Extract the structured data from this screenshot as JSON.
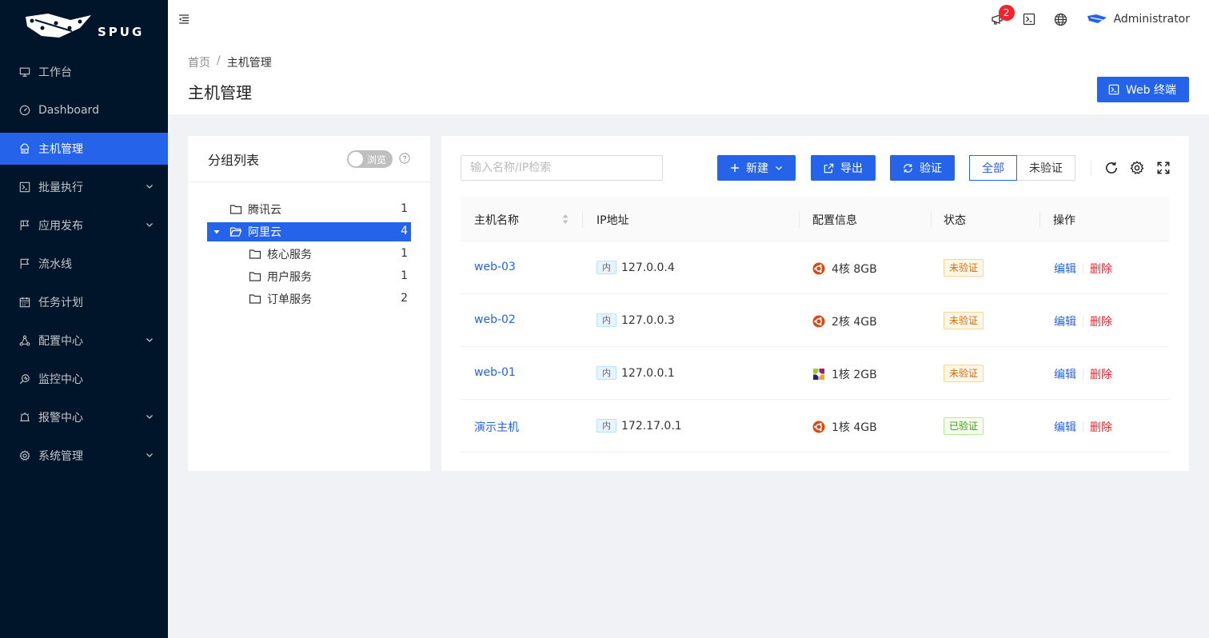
{
  "app": {
    "logo_text": "SPUG"
  },
  "sidebar": {
    "items": [
      {
        "label": "工作台",
        "icon": "desktop-icon",
        "has_children": false,
        "active": false
      },
      {
        "label": "Dashboard",
        "icon": "dashboard-icon",
        "has_children": false,
        "active": false
      },
      {
        "label": "主机管理",
        "icon": "cloud-server-icon",
        "has_children": false,
        "active": true
      },
      {
        "label": "批量执行",
        "icon": "code-icon",
        "has_children": true,
        "active": false
      },
      {
        "label": "应用发布",
        "icon": "flag-icon",
        "has_children": true,
        "active": false
      },
      {
        "label": "流水线",
        "icon": "pipeline-icon",
        "has_children": false,
        "active": false
      },
      {
        "label": "任务计划",
        "icon": "schedule-icon",
        "has_children": false,
        "active": false
      },
      {
        "label": "配置中心",
        "icon": "deployment-icon",
        "has_children": true,
        "active": false
      },
      {
        "label": "监控中心",
        "icon": "monitor-icon",
        "has_children": false,
        "active": false
      },
      {
        "label": "报警中心",
        "icon": "alert-icon",
        "has_children": true,
        "active": false
      },
      {
        "label": "系统管理",
        "icon": "setting-icon",
        "has_children": true,
        "active": false
      }
    ]
  },
  "header": {
    "notify_count": "2",
    "user_name": "Administrator"
  },
  "page": {
    "breadcrumb": [
      "首页",
      "主机管理"
    ],
    "title": "主机管理",
    "web_terminal_label": "Web 终端"
  },
  "groups": {
    "title": "分组列表",
    "switch_label": "浏览",
    "tree": [
      {
        "name": "腾讯云",
        "count": "1",
        "level": 1,
        "expanded": false,
        "selected": false
      },
      {
        "name": "阿里云",
        "count": "4",
        "level": 1,
        "expanded": true,
        "selected": true
      },
      {
        "name": "核心服务",
        "count": "1",
        "level": 2,
        "expanded": false,
        "selected": false
      },
      {
        "name": "用户服务",
        "count": "1",
        "level": 2,
        "expanded": false,
        "selected": false
      },
      {
        "name": "订单服务",
        "count": "2",
        "level": 2,
        "expanded": false,
        "selected": false
      }
    ]
  },
  "hosts": {
    "search_placeholder": "输入名称/IP检索",
    "new_label": "新建",
    "export_label": "导出",
    "verify_label": "验证",
    "filter_options": [
      "全部",
      "未验证"
    ],
    "filter_selected": "全部",
    "columns": [
      "主机名称",
      "IP地址",
      "配置信息",
      "状态",
      "操作"
    ],
    "rows": [
      {
        "name": "web-03",
        "ip_tag": "内",
        "ip": "127.0.0.4",
        "os": "ubuntu",
        "spec": "4核 8GB",
        "status": "未验证",
        "verified": false,
        "edit": "编辑",
        "delete": "删除"
      },
      {
        "name": "web-02",
        "ip_tag": "内",
        "ip": "127.0.0.3",
        "os": "ubuntu",
        "spec": "2核 4GB",
        "status": "未验证",
        "verified": false,
        "edit": "编辑",
        "delete": "删除"
      },
      {
        "name": "web-01",
        "ip_tag": "内",
        "ip": "127.0.0.1",
        "os": "centos",
        "spec": "1核 2GB",
        "status": "未验证",
        "verified": false,
        "edit": "编辑",
        "delete": "删除"
      },
      {
        "name": "演示主机",
        "ip_tag": "内",
        "ip": "172.17.0.1",
        "os": "ubuntu",
        "spec": "1核 4GB",
        "status": "已验证",
        "verified": true,
        "edit": "编辑",
        "delete": "删除"
      }
    ]
  },
  "colors": {
    "primary": "#2563eb",
    "sidebar_bg": "#001529",
    "danger": "#f5222d"
  }
}
